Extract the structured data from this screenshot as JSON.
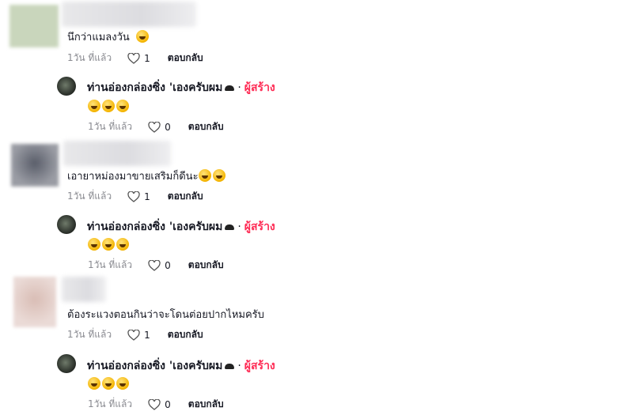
{
  "threads": [
    {
      "comment": {
        "text": "นึกว่าแมลงวัน",
        "emoji": [
          "grinning-sweat-emoji"
        ],
        "time": "1วัน ที่แล้ว",
        "likes": "1",
        "reply_label": "ตอบกลับ",
        "avatar_color": "#c9d6bc"
      },
      "reply": {
        "author": "ท่านอ่องกล่องซิ่ง 'เองครับผม",
        "separator": "·",
        "creator_badge": "ผู้สร้าง",
        "emoji_count": 3,
        "time": "1วัน ที่แล้ว",
        "likes": "0",
        "reply_label": "ตอบกลับ"
      }
    },
    {
      "comment": {
        "text": "เอายาหม่องมาขายเสริมก็ดีนะ",
        "emoji": [
          "smiling-sweat-emoji",
          "smiling-sweat-emoji"
        ],
        "time": "1วัน ที่แล้ว",
        "likes": "1",
        "reply_label": "ตอบกลับ",
        "avatar_color": "#7a7d88"
      },
      "reply": {
        "author": "ท่านอ่องกล่องซิ่ง 'เองครับผม",
        "separator": "·",
        "creator_badge": "ผู้สร้าง",
        "emoji_count": 3,
        "time": "1วัน ที่แล้ว",
        "likes": "0",
        "reply_label": "ตอบกลับ"
      }
    },
    {
      "comment": {
        "text": "ต้องระแวงตอนกินว่าจะโดนต่อยปากไหมครับ",
        "emoji": [],
        "time": "1วัน ที่แล้ว",
        "likes": "1",
        "reply_label": "ตอบกลับ",
        "avatar_color": "#e2ccc6"
      },
      "reply": {
        "author": "ท่านอ่องกล่องซิ่ง 'เองครับผม",
        "separator": "·",
        "creator_badge": "ผู้สร้าง",
        "emoji_count": 3,
        "time": "1วัน ที่แล้ว",
        "likes": "0",
        "reply_label": "ตอบกลับ"
      }
    }
  ],
  "colors": {
    "creator_accent": "#fe2c55",
    "meta_gray": "#8a8b91",
    "text": "#161823"
  }
}
